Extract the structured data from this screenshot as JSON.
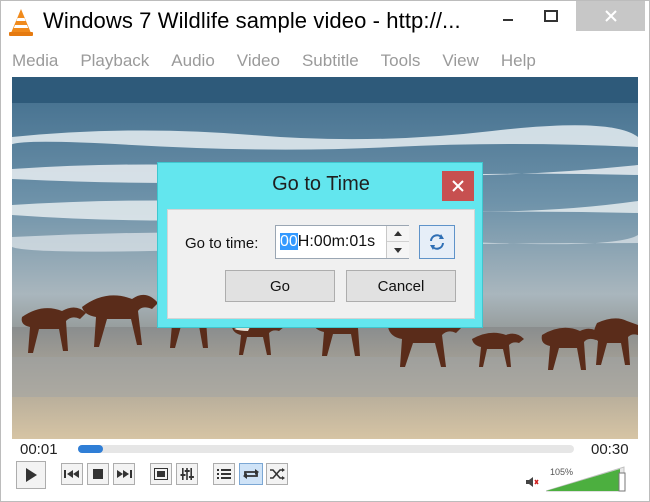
{
  "window": {
    "title": "Windows 7 Wildlife sample video - http://...",
    "app_icon": "vlc-cone-icon"
  },
  "menu": {
    "items": [
      "Media",
      "Playback",
      "Audio",
      "Video",
      "Subtitle",
      "Tools",
      "View",
      "Help"
    ]
  },
  "player": {
    "current_time": "00:01",
    "total_time": "00:30",
    "progress": 0.05,
    "volume_label": "105%",
    "volume_level": 1.05
  },
  "dialog": {
    "title": "Go to Time",
    "label": "Go to time:",
    "time_selected": "00",
    "time_rest": "H:00m:01s",
    "go_label": "Go",
    "cancel_label": "Cancel"
  },
  "colors": {
    "dialog_frame": "#63e6ee",
    "close_red": "#c75050",
    "accent_blue": "#2f7ed6",
    "selection": "#3399ff"
  }
}
